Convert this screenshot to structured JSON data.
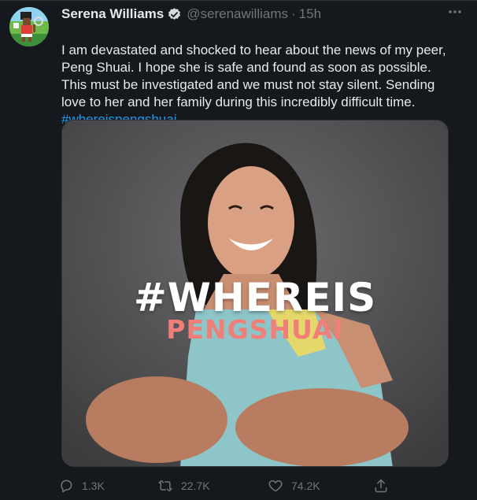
{
  "tweet": {
    "author_name": "Serena Williams",
    "handle": "@serenawilliams",
    "separator": "·",
    "time": "15h",
    "more_icon": "more-icon",
    "text": "I am devastated and shocked to hear about the news of my peer, Peng Shuai. I hope she is safe and found as soon as possible. This must be investigated and we must not stay silent. Sending love to her and her family during this incredibly difficult time.",
    "hashtag": "#whereispengshuai",
    "media": {
      "line1": "#WHEREIS",
      "line2": "PENGSHUAI"
    },
    "actions": {
      "reply_count": "1.3K",
      "retweet_count": "22.7K",
      "like_count": "74.2K"
    }
  },
  "colors": {
    "background": "#15181c",
    "text": "#e7e9ea",
    "secondary": "#71767b",
    "accent": "#1d9bf0",
    "overlay_pink": "#f07f79"
  }
}
